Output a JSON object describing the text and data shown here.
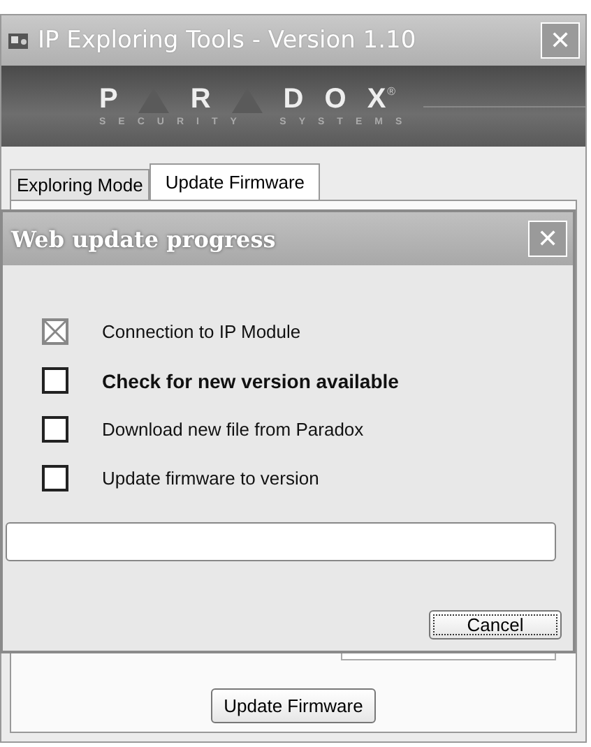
{
  "window": {
    "title": "IP Exploring Tools - Version 1.10",
    "close": "✕"
  },
  "logo": {
    "parts": [
      {
        "kind": "letter",
        "text": "P"
      },
      {
        "kind": "triangle"
      },
      {
        "kind": "letter",
        "text": "R"
      },
      {
        "kind": "triangle"
      },
      {
        "kind": "letter",
        "text": "D"
      },
      {
        "kind": "letter",
        "text": "O"
      },
      {
        "kind": "letter",
        "text": "X"
      }
    ],
    "registered": "®",
    "tagline": "SECURITY  SYSTEMS"
  },
  "tabs": [
    {
      "label": "Exploring Mode",
      "selected": false
    },
    {
      "label": "Update Firmware",
      "selected": true
    }
  ],
  "main_button": "Update Firmware",
  "dialog": {
    "title": "Web update progress",
    "close": "✕",
    "steps": [
      {
        "label": "Connection to IP Module",
        "checked": true,
        "active": false
      },
      {
        "label": "Check for new version available",
        "checked": false,
        "active": true
      },
      {
        "label": "Download new file from Paradox",
        "checked": false,
        "active": false
      },
      {
        "label": "Update firmware to version",
        "checked": false,
        "active": false
      }
    ],
    "cancel": "Cancel"
  }
}
